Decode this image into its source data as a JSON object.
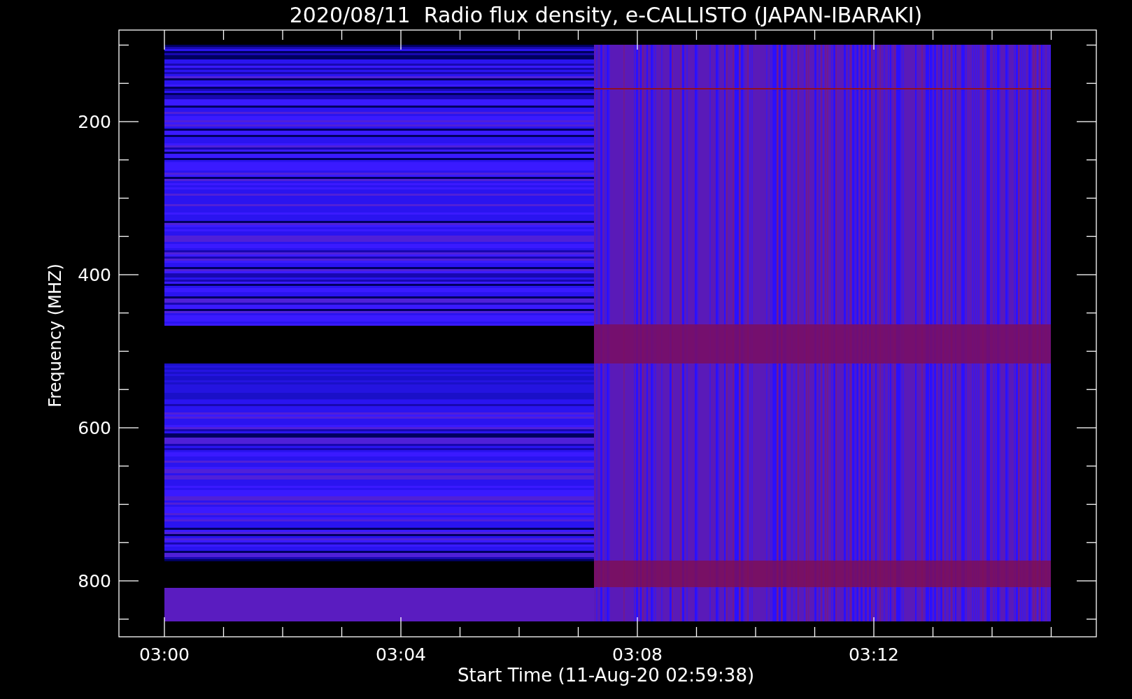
{
  "plot": {
    "title": "2020/08/11  Radio flux density, e-CALLISTO (JAPAN-IBARAKI)",
    "x_axis": {
      "label": "Start Time (11-Aug-20 02:59:38)",
      "tick_labels": [
        "03:00",
        "03:04",
        "03:08",
        "03:12"
      ]
    },
    "y_axis": {
      "label": "Frequency (MHZ)",
      "tick_labels": [
        "200",
        "400",
        "600",
        "800"
      ]
    }
  }
}
